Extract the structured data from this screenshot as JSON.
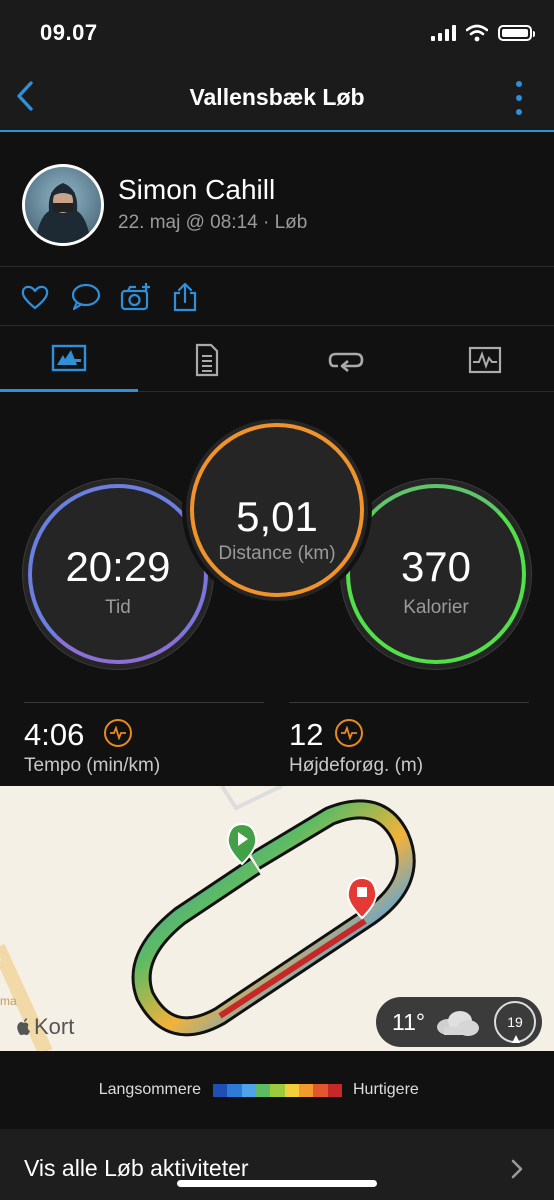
{
  "status_bar": {
    "time": "09.07",
    "icons": [
      "signal-icon",
      "wifi-icon",
      "battery-icon"
    ]
  },
  "header": {
    "title": "Vallensbæk Løb",
    "back_icon": "chevron-left-icon",
    "menu_icon": "more-vertical-icon"
  },
  "profile": {
    "name": "Simon Cahill",
    "meta": "22. maj @ 08:14 · Løb"
  },
  "actions": [
    {
      "name": "like",
      "icon": "heart-icon"
    },
    {
      "name": "comment",
      "icon": "comment-icon"
    },
    {
      "name": "add-photo",
      "icon": "camera-plus-icon"
    },
    {
      "name": "share",
      "icon": "share-icon"
    }
  ],
  "tabs": [
    {
      "name": "overview",
      "icon": "overview-icon",
      "active": true
    },
    {
      "name": "details",
      "icon": "document-icon",
      "active": false
    },
    {
      "name": "laps",
      "icon": "laps-icon",
      "active": false
    },
    {
      "name": "charts",
      "icon": "chart-icon",
      "active": false
    }
  ],
  "stats": {
    "time": {
      "value": "20:29",
      "label": "Tid"
    },
    "distance": {
      "value": "5,01",
      "label": "Distance (km)"
    },
    "calories": {
      "value": "370",
      "label": "Kalorier"
    }
  },
  "metrics": {
    "pace": {
      "value": "4:06",
      "label": "Tempo (min/km)"
    },
    "elevation": {
      "value": "12",
      "label": "Højdeforøg. (m)"
    }
  },
  "map": {
    "brand": "Kort",
    "temperature": "11°",
    "weather_icon": "cloud-icon",
    "wind_speed": "19",
    "edge_text": "ma"
  },
  "legend": {
    "slow_label": "Langsommere",
    "fast_label": "Hurtigere",
    "colors": [
      "#1f4fb5",
      "#2f7ad6",
      "#4fa3e8",
      "#5dbb63",
      "#9ccc3c",
      "#f3d03a",
      "#f39a2c",
      "#e4572e",
      "#c62828"
    ]
  },
  "footer": {
    "view_all_label": "Vis alle Løb aktiviteter"
  },
  "colors": {
    "accent": "#2f8fd8",
    "time_ring": "#6a7fe0",
    "distance_ring": "#f0932b",
    "calories_ring": "#52e04a",
    "metric_icon": "#e88a1e"
  }
}
